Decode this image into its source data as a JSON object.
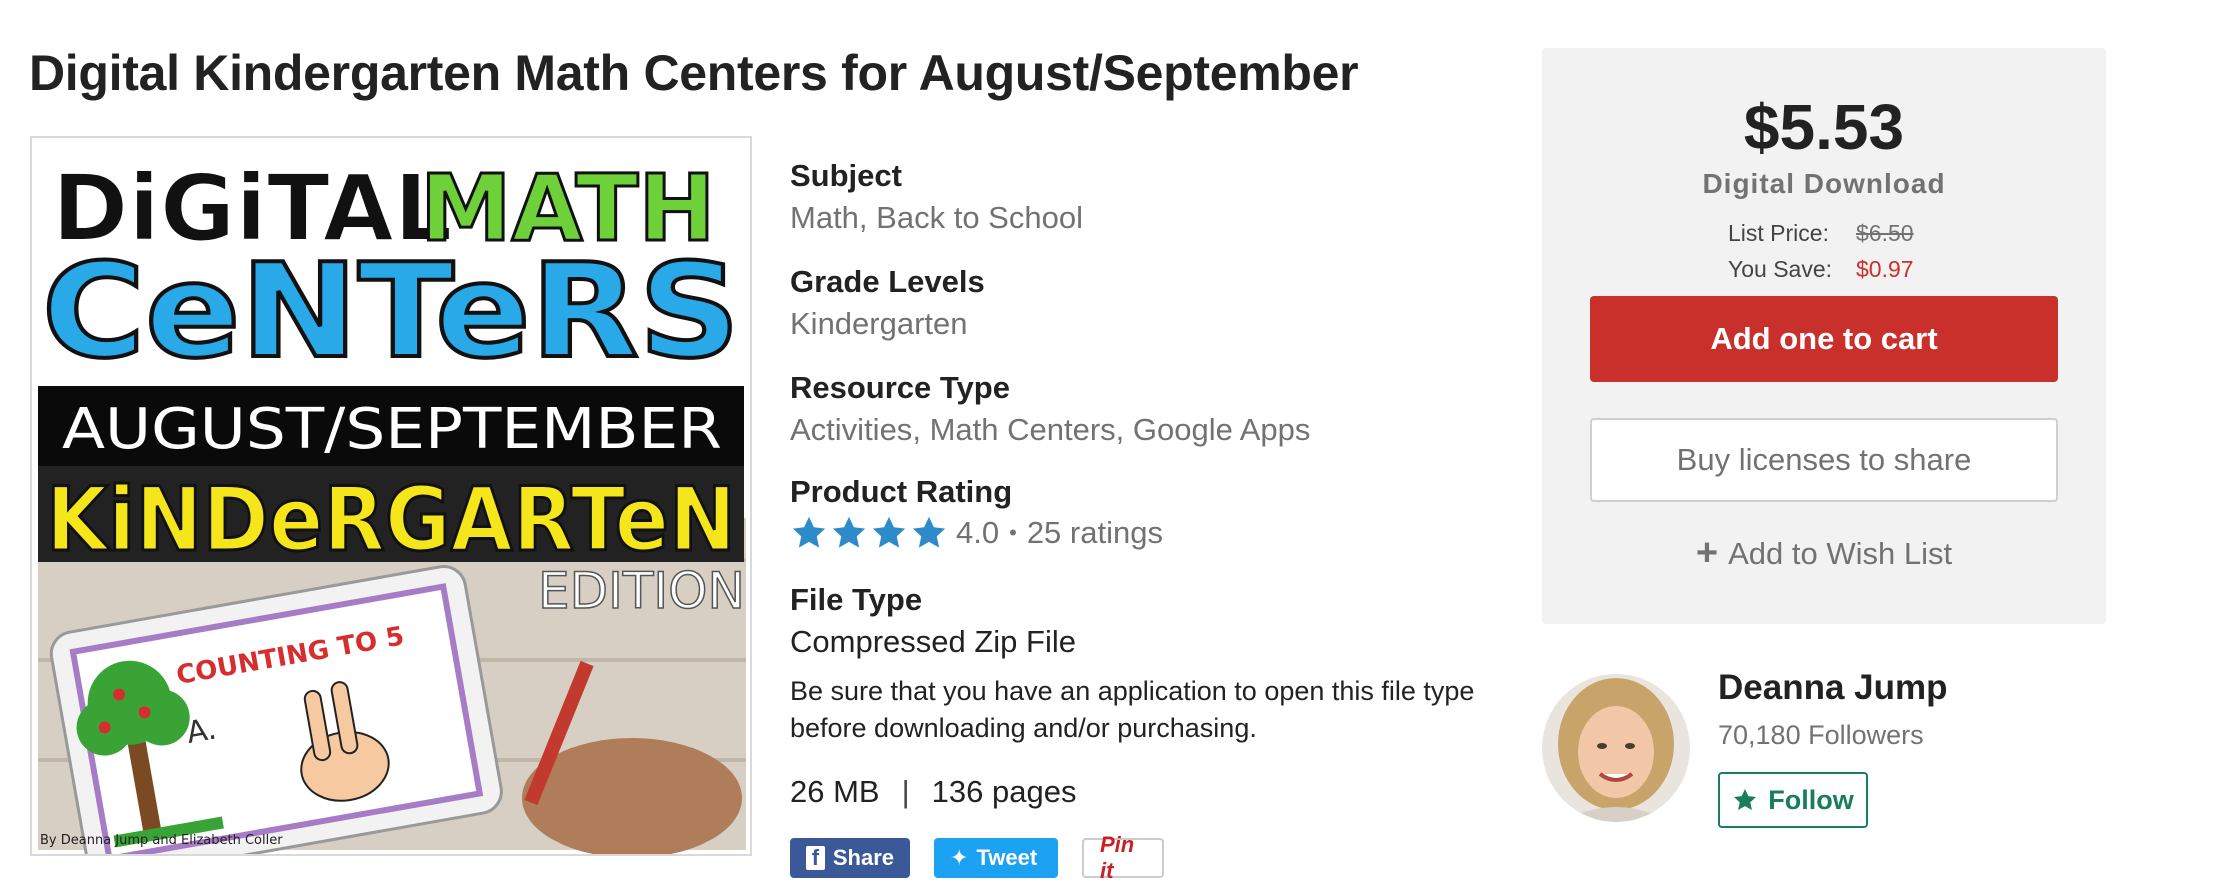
{
  "product": {
    "title": "Digital Kindergarten Math Centers for August/September",
    "cover": {
      "line1a": "DiGiTAL",
      "line1b": "MATH",
      "line2": "CeNTeRS",
      "band": "AUGUST/SEPTEMBER",
      "line3": "KiNDeRGARTeN",
      "edition": "EDITION",
      "card_text": "COUNTING TO 5",
      "card_letter": "A.",
      "credit": "By Deanna Jump and Elizabeth Coller"
    }
  },
  "details": {
    "subject_label": "Subject",
    "subject_values": [
      "Math",
      "Back to School"
    ],
    "grade_label": "Grade Levels",
    "grade_value": "Kindergarten",
    "resource_label": "Resource Type",
    "resource_values": [
      "Activities",
      "Math Centers",
      "Google Apps"
    ],
    "rating_label": "Product Rating",
    "rating_value": "4.0",
    "rating_stars": 4,
    "rating_dot": "•",
    "rating_count": "25 ratings",
    "filetype_label": "File Type",
    "filetype_value": "Compressed Zip File",
    "filetype_note": "Be sure that you have an application to open this file type before downloading and/or purchasing.",
    "size": "26 MB",
    "pipe": "|",
    "pages": "136 pages",
    "comma": ","
  },
  "share": {
    "facebook": "Share",
    "twitter": "Tweet",
    "pinterest": "Pin it"
  },
  "purchase": {
    "price": "$5.53",
    "format": "Digital Download",
    "list_price_label": "List Price:",
    "list_price": "$6.50",
    "you_save_label": "You Save:",
    "you_save": "$0.97",
    "add_to_cart": "Add one to cart",
    "buy_licenses": "Buy licenses to share",
    "wish_plus": "+",
    "wish_list": "Add to Wish List"
  },
  "seller": {
    "name": "Deanna Jump",
    "followers": "70,180 Followers",
    "follow": "Follow"
  },
  "colors": {
    "accent_red": "#c9302c",
    "star_blue": "#2d8bc9",
    "follow_green": "#1a7d5e"
  }
}
